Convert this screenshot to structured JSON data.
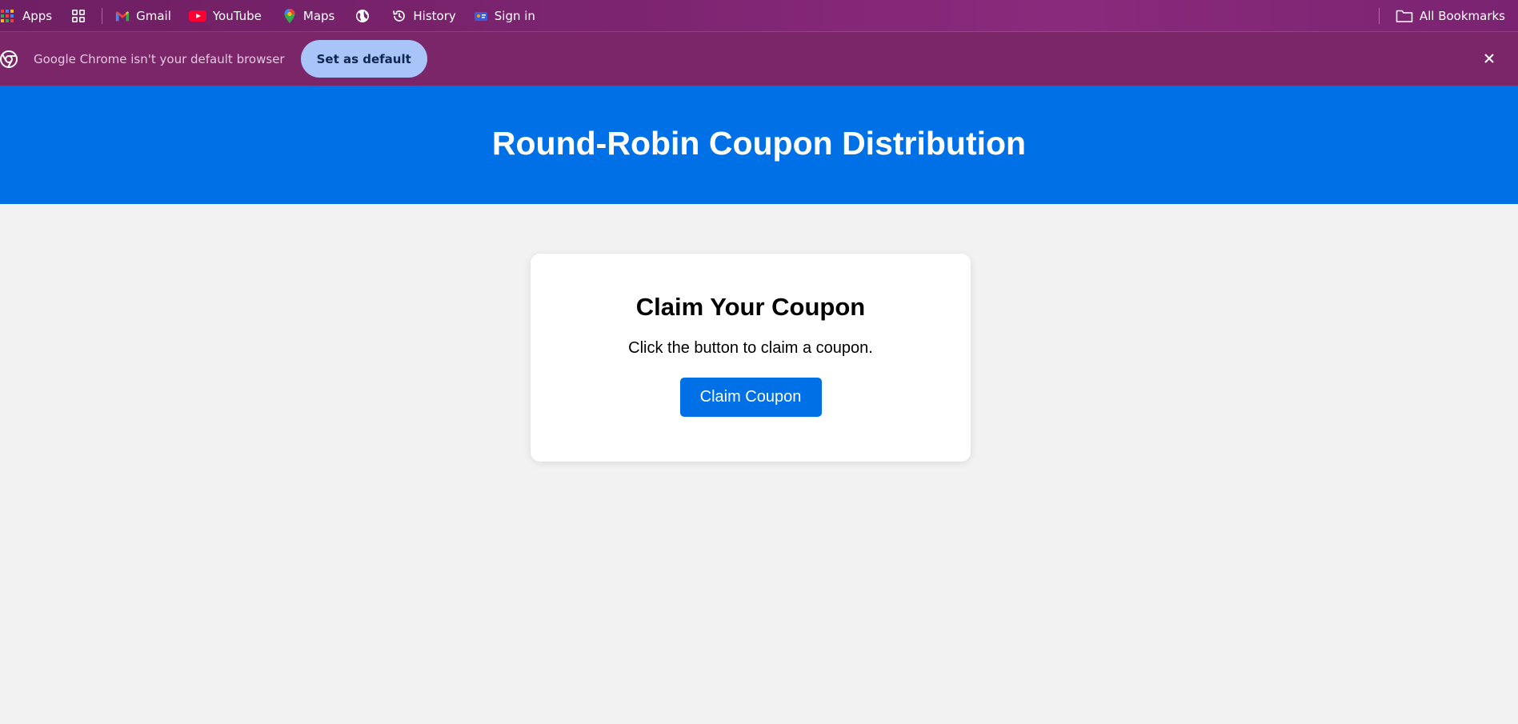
{
  "bookmarks_bar": {
    "items": [
      {
        "label": "Apps",
        "icon": "apps-grid-icon"
      },
      {
        "label": "",
        "icon": "tab-groups-icon"
      },
      {
        "label": "Gmail",
        "icon": "gmail-icon"
      },
      {
        "label": "YouTube",
        "icon": "youtube-icon"
      },
      {
        "label": "Maps",
        "icon": "maps-icon"
      },
      {
        "label": "",
        "icon": "globe-icon"
      },
      {
        "label": "History",
        "icon": "history-icon"
      },
      {
        "label": "Sign in",
        "icon": "sign-in-icon"
      }
    ],
    "all_bookmarks": {
      "label": "All Bookmarks",
      "icon": "folder-icon"
    }
  },
  "infobar": {
    "message": "Google Chrome isn't your default browser",
    "button_label": "Set as default",
    "close_icon": "close-icon",
    "icon": "chrome-icon"
  },
  "header": {
    "title": "Round-Robin Coupon Distribution",
    "background": "#0070e6"
  },
  "card": {
    "title": "Claim Your Coupon",
    "description": "Click the button to claim a coupon.",
    "button_label": "Claim Coupon",
    "button_color": "#0070e6"
  },
  "colors": {
    "page_background": "#f2f2f2",
    "chrome_frame": "#7a2668",
    "set_default_button": "#a8c4f8"
  }
}
